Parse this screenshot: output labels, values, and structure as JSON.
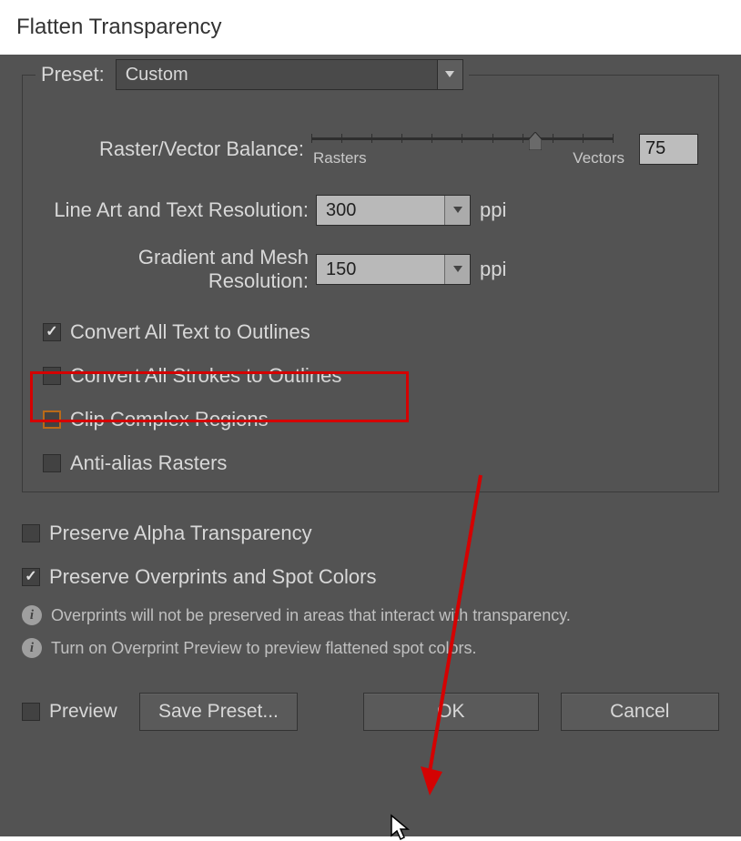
{
  "title": "Flatten Transparency",
  "preset": {
    "label": "Preset:",
    "value": "Custom"
  },
  "rasterVector": {
    "label": "Raster/Vector Balance:",
    "leftLabel": "Rasters",
    "rightLabel": "Vectors",
    "value": "75"
  },
  "lineArt": {
    "label": "Line Art and Text Resolution:",
    "value": "300",
    "unit": "ppi"
  },
  "gradient": {
    "label": "Gradient and Mesh Resolution:",
    "value": "150",
    "unit": "ppi"
  },
  "checks": {
    "convertText": "Convert All Text to Outlines",
    "convertStrokes": "Convert All Strokes to Outlines",
    "clipRegions": "Clip Complex Regions",
    "antiAlias": "Anti-alias Rasters",
    "preserveAlpha": "Preserve Alpha Transparency",
    "preserveOverprints": "Preserve Overprints and Spot Colors"
  },
  "info": {
    "line1": "Overprints will not be preserved in areas that interact with transparency.",
    "line2": "Turn on Overprint Preview to preview flattened spot colors."
  },
  "bottom": {
    "preview": "Preview",
    "save": "Save Preset...",
    "ok": "OK",
    "cancel": "Cancel"
  }
}
